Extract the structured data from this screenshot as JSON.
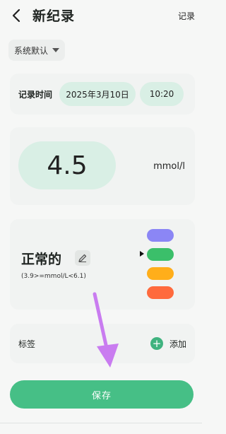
{
  "header": {
    "title": "新纪录",
    "right_label": "记录",
    "back_icon": "chevron-left-icon"
  },
  "preset": {
    "label": "系统默认",
    "icon": "caret-down-icon"
  },
  "time_card": {
    "label": "记录时间",
    "date": "2025年3月10日",
    "time": "10:20"
  },
  "value_card": {
    "value": "4.5",
    "unit": "mmol/l"
  },
  "status_card": {
    "name": "正常的",
    "range": "(3.9>=mmol/L<6.1)",
    "edit_icon": "pencil-icon",
    "swatches": [
      {
        "color": "#8b86f5",
        "selected": false
      },
      {
        "color": "#3bbf6a",
        "selected": true
      },
      {
        "color": "#ffae1a",
        "selected": false
      },
      {
        "color": "#ff6a3d",
        "selected": false
      }
    ]
  },
  "tags_card": {
    "label": "标签",
    "add_label": "添加",
    "add_icon": "plus-circle-icon"
  },
  "save_button": {
    "label": "保存",
    "color": "#46bf86"
  },
  "annotation": {
    "type": "arrow",
    "color": "#c97cf0"
  }
}
